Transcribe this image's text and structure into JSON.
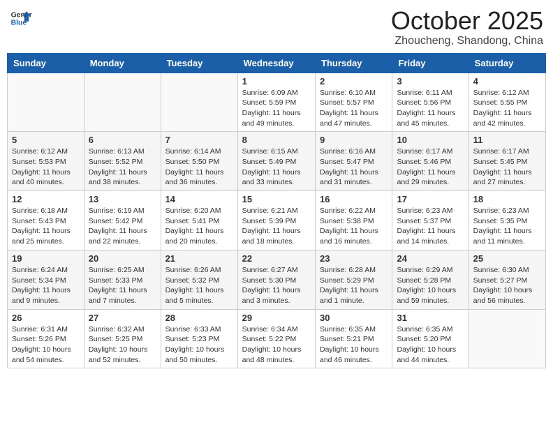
{
  "header": {
    "logo_line1": "General",
    "logo_line2": "Blue",
    "month": "October 2025",
    "location": "Zhoucheng, Shandong, China"
  },
  "weekdays": [
    "Sunday",
    "Monday",
    "Tuesday",
    "Wednesday",
    "Thursday",
    "Friday",
    "Saturday"
  ],
  "weeks": [
    [
      {
        "day": "",
        "info": ""
      },
      {
        "day": "",
        "info": ""
      },
      {
        "day": "",
        "info": ""
      },
      {
        "day": "1",
        "info": "Sunrise: 6:09 AM\nSunset: 5:59 PM\nDaylight: 11 hours\nand 49 minutes."
      },
      {
        "day": "2",
        "info": "Sunrise: 6:10 AM\nSunset: 5:57 PM\nDaylight: 11 hours\nand 47 minutes."
      },
      {
        "day": "3",
        "info": "Sunrise: 6:11 AM\nSunset: 5:56 PM\nDaylight: 11 hours\nand 45 minutes."
      },
      {
        "day": "4",
        "info": "Sunrise: 6:12 AM\nSunset: 5:55 PM\nDaylight: 11 hours\nand 42 minutes."
      }
    ],
    [
      {
        "day": "5",
        "info": "Sunrise: 6:12 AM\nSunset: 5:53 PM\nDaylight: 11 hours\nand 40 minutes."
      },
      {
        "day": "6",
        "info": "Sunrise: 6:13 AM\nSunset: 5:52 PM\nDaylight: 11 hours\nand 38 minutes."
      },
      {
        "day": "7",
        "info": "Sunrise: 6:14 AM\nSunset: 5:50 PM\nDaylight: 11 hours\nand 36 minutes."
      },
      {
        "day": "8",
        "info": "Sunrise: 6:15 AM\nSunset: 5:49 PM\nDaylight: 11 hours\nand 33 minutes."
      },
      {
        "day": "9",
        "info": "Sunrise: 6:16 AM\nSunset: 5:47 PM\nDaylight: 11 hours\nand 31 minutes."
      },
      {
        "day": "10",
        "info": "Sunrise: 6:17 AM\nSunset: 5:46 PM\nDaylight: 11 hours\nand 29 minutes."
      },
      {
        "day": "11",
        "info": "Sunrise: 6:17 AM\nSunset: 5:45 PM\nDaylight: 11 hours\nand 27 minutes."
      }
    ],
    [
      {
        "day": "12",
        "info": "Sunrise: 6:18 AM\nSunset: 5:43 PM\nDaylight: 11 hours\nand 25 minutes."
      },
      {
        "day": "13",
        "info": "Sunrise: 6:19 AM\nSunset: 5:42 PM\nDaylight: 11 hours\nand 22 minutes."
      },
      {
        "day": "14",
        "info": "Sunrise: 6:20 AM\nSunset: 5:41 PM\nDaylight: 11 hours\nand 20 minutes."
      },
      {
        "day": "15",
        "info": "Sunrise: 6:21 AM\nSunset: 5:39 PM\nDaylight: 11 hours\nand 18 minutes."
      },
      {
        "day": "16",
        "info": "Sunrise: 6:22 AM\nSunset: 5:38 PM\nDaylight: 11 hours\nand 16 minutes."
      },
      {
        "day": "17",
        "info": "Sunrise: 6:23 AM\nSunset: 5:37 PM\nDaylight: 11 hours\nand 14 minutes."
      },
      {
        "day": "18",
        "info": "Sunrise: 6:23 AM\nSunset: 5:35 PM\nDaylight: 11 hours\nand 11 minutes."
      }
    ],
    [
      {
        "day": "19",
        "info": "Sunrise: 6:24 AM\nSunset: 5:34 PM\nDaylight: 11 hours\nand 9 minutes."
      },
      {
        "day": "20",
        "info": "Sunrise: 6:25 AM\nSunset: 5:33 PM\nDaylight: 11 hours\nand 7 minutes."
      },
      {
        "day": "21",
        "info": "Sunrise: 6:26 AM\nSunset: 5:32 PM\nDaylight: 11 hours\nand 5 minutes."
      },
      {
        "day": "22",
        "info": "Sunrise: 6:27 AM\nSunset: 5:30 PM\nDaylight: 11 hours\nand 3 minutes."
      },
      {
        "day": "23",
        "info": "Sunrise: 6:28 AM\nSunset: 5:29 PM\nDaylight: 11 hours\nand 1 minute."
      },
      {
        "day": "24",
        "info": "Sunrise: 6:29 AM\nSunset: 5:28 PM\nDaylight: 10 hours\nand 59 minutes."
      },
      {
        "day": "25",
        "info": "Sunrise: 6:30 AM\nSunset: 5:27 PM\nDaylight: 10 hours\nand 56 minutes."
      }
    ],
    [
      {
        "day": "26",
        "info": "Sunrise: 6:31 AM\nSunset: 5:26 PM\nDaylight: 10 hours\nand 54 minutes."
      },
      {
        "day": "27",
        "info": "Sunrise: 6:32 AM\nSunset: 5:25 PM\nDaylight: 10 hours\nand 52 minutes."
      },
      {
        "day": "28",
        "info": "Sunrise: 6:33 AM\nSunset: 5:23 PM\nDaylight: 10 hours\nand 50 minutes."
      },
      {
        "day": "29",
        "info": "Sunrise: 6:34 AM\nSunset: 5:22 PM\nDaylight: 10 hours\nand 48 minutes."
      },
      {
        "day": "30",
        "info": "Sunrise: 6:35 AM\nSunset: 5:21 PM\nDaylight: 10 hours\nand 46 minutes."
      },
      {
        "day": "31",
        "info": "Sunrise: 6:35 AM\nSunset: 5:20 PM\nDaylight: 10 hours\nand 44 minutes."
      },
      {
        "day": "",
        "info": ""
      }
    ]
  ]
}
